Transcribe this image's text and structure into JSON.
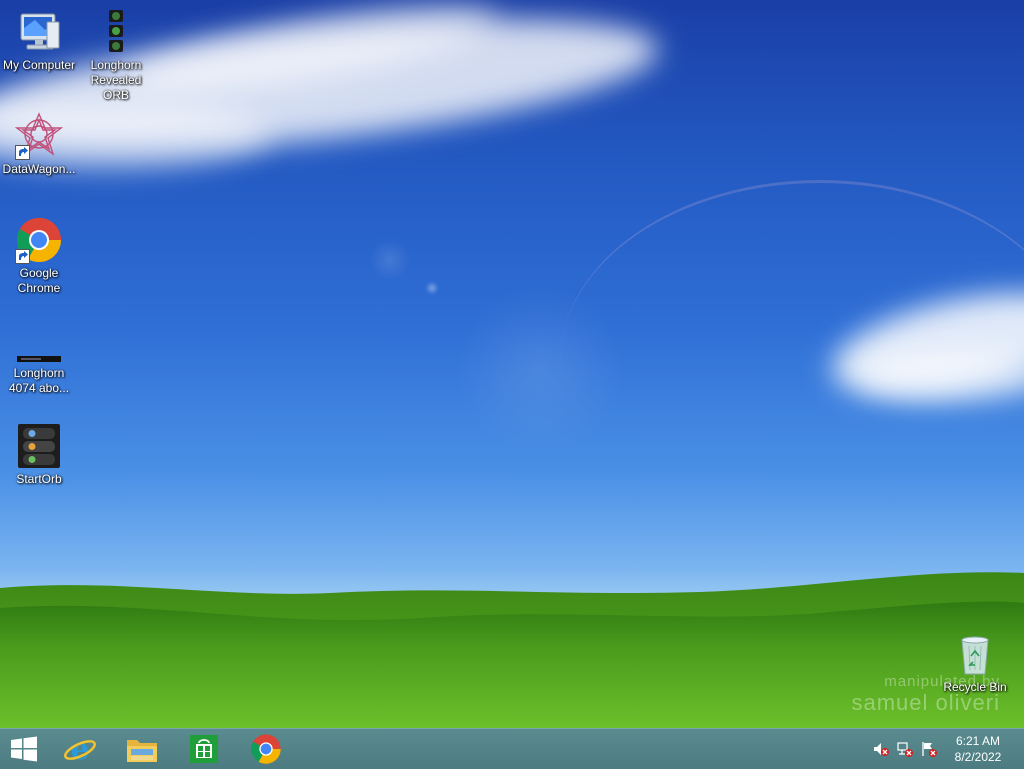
{
  "desktop": {
    "icons": [
      {
        "label": "My Computer"
      },
      {
        "label": "Longhorn Revealed ORB"
      },
      {
        "label": "DataWagon..."
      },
      {
        "label": "Google Chrome"
      },
      {
        "label": "Longhorn 4074 abo..."
      },
      {
        "label": "StartOrb"
      },
      {
        "label": "Recycle Bin"
      }
    ],
    "watermark": {
      "line1": "manipulated by",
      "line2": "samuel oliveri"
    }
  },
  "taskbar": {
    "pinned": [
      {
        "name": "start-button",
        "icon": "windows-logo"
      },
      {
        "name": "internet-explorer",
        "icon": "ie-icon"
      },
      {
        "name": "file-explorer",
        "icon": "folder-icon"
      },
      {
        "name": "store",
        "icon": "store-icon"
      },
      {
        "name": "google-chrome",
        "icon": "chrome-icon"
      }
    ],
    "tray": {
      "icons": [
        "volume-muted-icon",
        "network-icon",
        "action-center-flag-icon"
      ],
      "time": "6:21 AM",
      "date": "8/2/2022"
    }
  },
  "colors": {
    "taskbar": "#4f8085",
    "sky_top": "#1a3fa6",
    "grass": "#4fa51a"
  }
}
